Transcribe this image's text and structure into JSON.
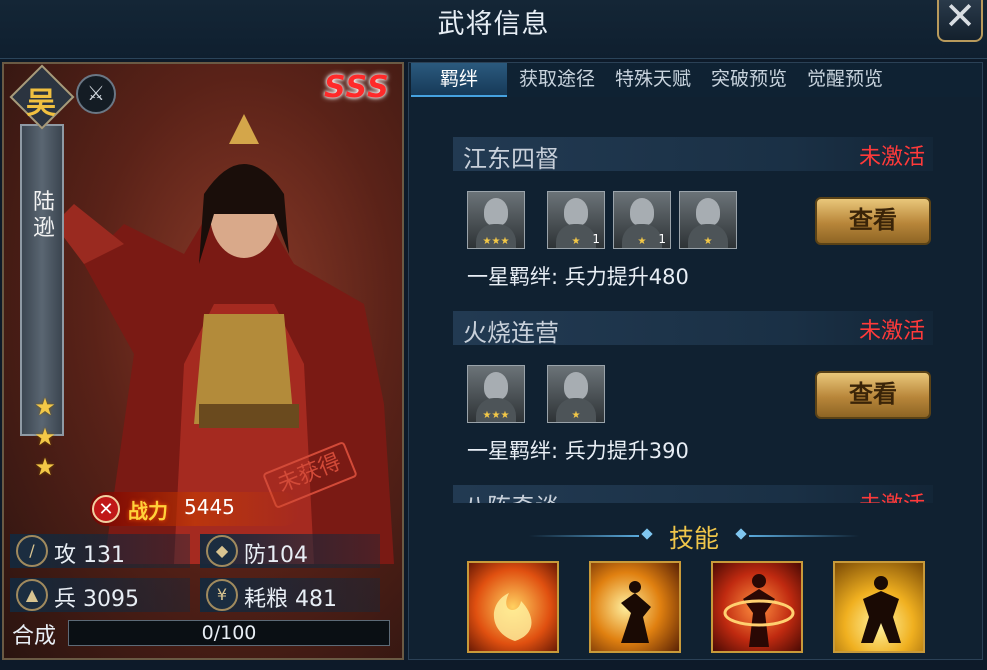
{
  "header": {
    "title": "武将信息",
    "close_icon": "✕"
  },
  "hero": {
    "faction": "吴",
    "name": "陆逊",
    "rank": "SSS",
    "stars": 3,
    "stamp": "未获得",
    "power_label": "战力",
    "power_value": "5445",
    "stats": {
      "attack": "攻 131",
      "defense": "防104",
      "troops": "兵 3095",
      "food": "耗粮 481"
    },
    "synthesis": {
      "label": "合成",
      "progress": "0/100",
      "fraction": 0
    }
  },
  "tabs": [
    "羁绊",
    "获取途径",
    "特殊天赋",
    "突破预览",
    "觉醒预览"
  ],
  "active_tab": 0,
  "bonds": [
    {
      "name": "江东四督",
      "status": "未激活",
      "portraits": [
        {
          "stars": "★★★",
          "count": ""
        },
        {
          "stars": "★",
          "count": "1"
        },
        {
          "stars": "★",
          "count": "1"
        },
        {
          "stars": "★",
          "count": ""
        }
      ],
      "button": "查看",
      "desc": "一星羁绊: 兵力提升480"
    },
    {
      "name": "火烧连营",
      "status": "未激活",
      "portraits": [
        {
          "stars": "★★★",
          "count": ""
        },
        {
          "stars": "★",
          "count": ""
        }
      ],
      "button": "查看",
      "desc": "一星羁绊: 兵力提升390"
    },
    {
      "name": "八阵奇谈",
      "status": "未激活"
    }
  ],
  "skills": {
    "title": "技能",
    "items": [
      "fire-swirl-icon",
      "fire-strike-icon",
      "fire-dash-icon",
      "fire-stance-icon"
    ]
  },
  "colors": {
    "accent_gold": "#f0c64a",
    "status_red": "#ff3a3a",
    "tab_active": "#2b5a7e"
  }
}
